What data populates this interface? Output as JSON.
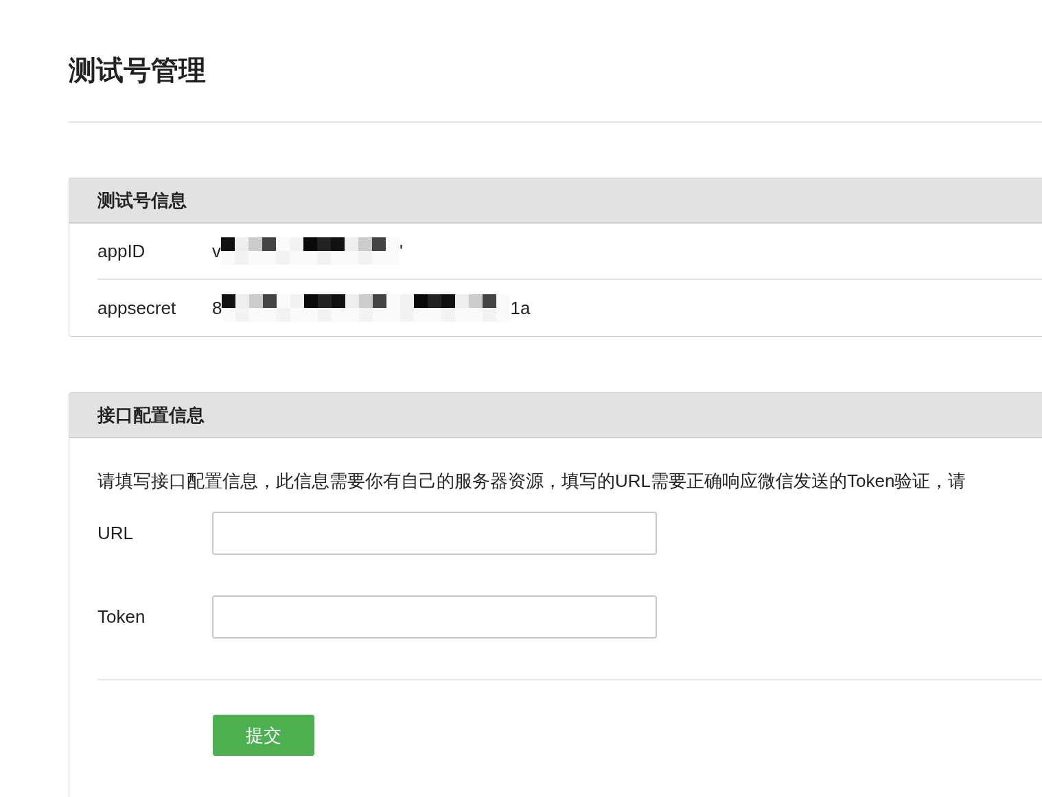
{
  "page_title": "测试号管理",
  "test_account": {
    "title": "测试号信息",
    "rows": [
      {
        "label": "appID",
        "value_start": "v",
        "value_end": "'"
      },
      {
        "label": "appsecret",
        "value_start": "8",
        "value_end": "1a"
      }
    ]
  },
  "interface_config": {
    "title": "接口配置信息",
    "description": "请填写接口配置信息，此信息需要你有自己的服务器资源，填写的URL需要正确响应微信发送的Token验证，请",
    "fields": [
      {
        "label": "URL"
      },
      {
        "label": "Token"
      }
    ],
    "submit": "提交"
  }
}
